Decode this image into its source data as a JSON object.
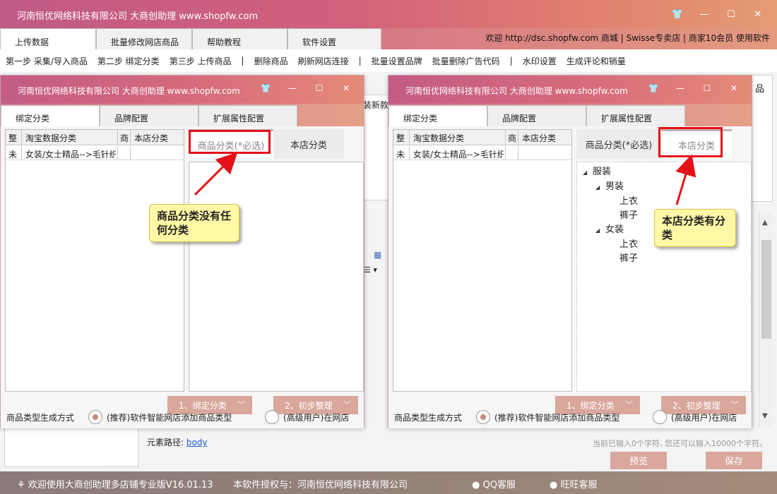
{
  "window": {
    "title": "河南恒优网络科技有限公司 大商创助理 www.shopfw.com",
    "shirt_icon": "👕",
    "minimize": "—",
    "maximize": "☐",
    "close": "✕"
  },
  "main_tabs": [
    "上传数据",
    "批量修改网店商品",
    "帮助教程",
    "软件设置"
  ],
  "header_info": "欢迎 http://dsc.shopfw.com 商城 | Swisse专卖店 | 商家10会员 使用软件",
  "steps": [
    "第一步 采集/导入商品",
    "第二步 绑定分类",
    "第三步 上传商品",
    "|",
    "删除商品",
    "刷新网店连接",
    "|",
    "批量设置品牌",
    "批量删除广告代码",
    "|",
    "水印设置",
    "生成评论和销量"
  ],
  "background": {
    "peek_text_1": "装新款",
    "peek_text_2": "品",
    "element_path_label": "元素路径:",
    "element_path_link": "body",
    "char_counter": "当前已输入0个字符, 您还可以输入10000个字符。",
    "preview_button": "预览",
    "save_button": "保存"
  },
  "status_bar": {
    "welcome": "欢迎使用大商创助理多店铺专业版V16.01.13",
    "license": "本软件授权与：河南恒优网络科技有限公司",
    "qq": "QQ客服",
    "wangwang": "旺旺客服"
  },
  "dialog": {
    "title": "河南恒优网络科技有限公司 大商创助理 www.shopfw.com",
    "tabs": [
      "绑定分类",
      "品牌配置",
      "扩展属性配置"
    ],
    "grid_headers": [
      "整",
      "淘宝数据分类",
      "商",
      "本店分类"
    ],
    "grid_row": [
      "未",
      "女装/女士精品-->毛针织"
    ],
    "sub_tab_goods": "商品分类(*必选)",
    "sub_tab_shop": "本店分类",
    "btn_bind": "1、绑定分类",
    "btn_tidy": "2、初步整理",
    "gen_label": "商品类型生成方式",
    "radio_recommended": "(推荐)软件智能网店添加商品类型",
    "radio_advanced": "(高级用户)在网店"
  },
  "tree": {
    "root": "服装",
    "men": "男装",
    "women": "女装",
    "top": "上衣",
    "pants": "裤子"
  },
  "callouts": {
    "left": "商品分类没有任何分类",
    "right": "本店分类有分类"
  },
  "colors": {
    "accent_red": "#e4101a",
    "callout_bg": "#fff8a6",
    "button": "#d9a79c"
  }
}
